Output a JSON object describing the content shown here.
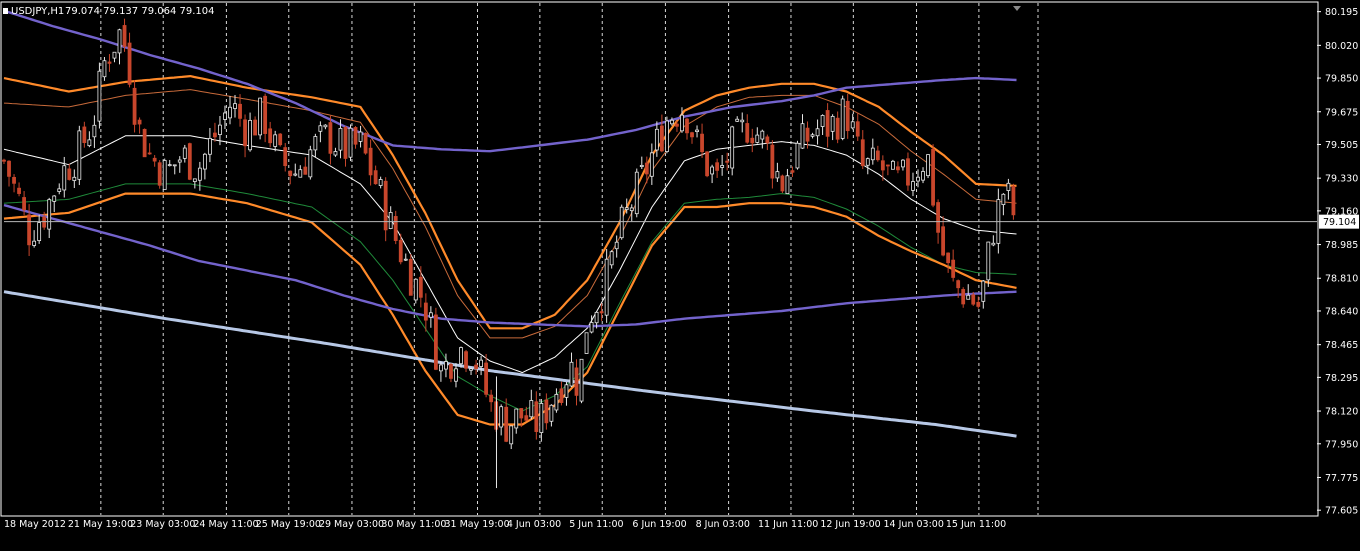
{
  "header": {
    "symbol": "USDJPY,H1",
    "ohlc": "79.074 79.137 79.064 79.104"
  },
  "colors": {
    "background": "#000000",
    "frame": "#ffffff",
    "grid": "#ffffff",
    "bull": "#e8e8e8",
    "bear": "#c8462c",
    "orange_band": "#ff8a2a",
    "thin_band": "#c86a3a",
    "mid_line": "#ffffff",
    "green_line": "#1f8a3a",
    "purple_band": "#7363cc",
    "lightblue_line": "#b7c8e6",
    "price_line": "#b8b8b8"
  },
  "chart_data": {
    "type": "candlestick",
    "title": "USDJPY,H1",
    "current_price": 79.104,
    "ylim": [
      77.58,
      80.24
    ],
    "y_ticks": [
      80.195,
      80.02,
      79.85,
      79.675,
      79.505,
      79.33,
      79.16,
      78.985,
      78.81,
      78.64,
      78.465,
      78.295,
      78.12,
      77.95,
      77.775,
      77.605
    ],
    "x_range": [
      0,
      100
    ],
    "x_ticks": [
      {
        "x": 0.0,
        "label": "18 May 2012"
      },
      {
        "x": 8.5,
        "label": "21 May 19:00"
      },
      {
        "x": 16.2,
        "label": "23 May 03:00"
      },
      {
        "x": 24.0,
        "label": "24 May 11:00"
      },
      {
        "x": 31.7,
        "label": "25 May 19:00"
      },
      {
        "x": 39.5,
        "label": "29 May 03:00"
      },
      {
        "x": 47.2,
        "label": "30 May 11:00"
      },
      {
        "x": 55.0,
        "label": "31 May 19:00"
      },
      {
        "x": 62.7,
        "label": "4 Jun 03:00"
      },
      {
        "x": 70.4,
        "label": "5 Jun 11:00"
      },
      {
        "x": 78.2,
        "label": "6 Jun 19:00"
      },
      {
        "x": 86.0,
        "label": "8 Jun 03:00"
      },
      {
        "x": 93.7,
        "label": "11 Jun 11:00"
      },
      {
        "x": 101.4,
        "label": "12 Jun 19:00"
      },
      {
        "x": 109.2,
        "label": "14 Jun 03:00"
      },
      {
        "x": 116.9,
        "label": "15 Jun 11:00"
      }
    ],
    "price_path": [
      [
        0,
        79.42
      ],
      [
        2,
        79.2
      ],
      [
        3,
        79.05
      ],
      [
        5,
        79.15
      ],
      [
        7,
        79.35
      ],
      [
        9,
        79.45
      ],
      [
        11,
        79.62
      ],
      [
        12.5,
        79.95
      ],
      [
        14.5,
        80.1
      ],
      [
        15.5,
        79.9
      ],
      [
        16.5,
        79.6
      ],
      [
        18,
        79.45
      ],
      [
        20,
        79.35
      ],
      [
        22,
        79.45
      ],
      [
        24,
        79.38
      ],
      [
        26,
        79.55
      ],
      [
        28,
        79.72
      ],
      [
        30,
        79.58
      ],
      [
        32,
        79.66
      ],
      [
        34,
        79.42
      ],
      [
        36,
        79.36
      ],
      [
        38,
        79.48
      ],
      [
        40,
        79.55
      ],
      [
        42,
        79.48
      ],
      [
        44,
        79.5
      ],
      [
        46,
        79.3
      ],
      [
        48,
        79.05
      ],
      [
        50,
        78.85
      ],
      [
        52,
        78.68
      ],
      [
        54,
        78.32
      ],
      [
        56,
        78.45
      ],
      [
        58,
        78.42
      ],
      [
        60,
        78.15
      ],
      [
        62,
        78.05
      ],
      [
        64,
        78.1
      ],
      [
        66,
        78.05
      ],
      [
        68,
        78.22
      ],
      [
        70,
        78.35
      ],
      [
        71,
        78.25
      ],
      [
        72,
        78.6
      ],
      [
        74,
        78.75
      ],
      [
        76,
        79.05
      ],
      [
        78,
        79.25
      ],
      [
        80,
        79.45
      ],
      [
        82,
        79.65
      ],
      [
        84,
        79.7
      ],
      [
        86,
        79.45
      ],
      [
        88,
        79.32
      ],
      [
        90,
        79.5
      ],
      [
        92,
        79.62
      ],
      [
        94,
        79.5
      ],
      [
        96,
        79.3
      ],
      [
        98,
        79.48
      ],
      [
        100,
        79.58
      ],
      [
        102,
        79.6
      ],
      [
        104,
        79.68
      ],
      [
        106,
        79.38
      ],
      [
        108,
        79.4
      ],
      [
        110,
        79.3
      ],
      [
        112,
        79.35
      ],
      [
        114,
        79.45
      ],
      [
        115.5,
        79.0
      ],
      [
        117,
        78.78
      ],
      [
        119,
        78.72
      ],
      [
        120.5,
        78.66
      ],
      [
        122,
        79.05
      ],
      [
        123.5,
        79.28
      ],
      [
        125,
        79.104
      ]
    ],
    "overlays": [
      {
        "role": "orange_upper",
        "x": [
          0,
          8,
          15,
          23,
          30,
          38,
          44,
          48,
          52,
          56,
          60,
          64,
          68,
          72,
          76,
          80,
          84,
          88,
          92,
          96,
          100,
          104,
          108,
          112,
          116,
          120,
          125
        ],
        "y": [
          79.85,
          79.78,
          79.83,
          79.86,
          79.8,
          79.75,
          79.7,
          79.45,
          79.15,
          78.8,
          78.55,
          78.55,
          78.62,
          78.8,
          79.1,
          79.45,
          79.68,
          79.76,
          79.8,
          79.82,
          79.82,
          79.78,
          79.7,
          79.57,
          79.45,
          79.3,
          79.29
        ]
      },
      {
        "role": "thin_upper",
        "x": [
          0,
          8,
          15,
          23,
          30,
          38,
          44,
          48,
          52,
          56,
          60,
          64,
          68,
          72,
          76,
          80,
          84,
          88,
          92,
          96,
          100,
          104,
          108,
          112,
          116,
          120,
          125
        ],
        "y": [
          79.72,
          79.7,
          79.76,
          79.79,
          79.74,
          79.68,
          79.62,
          79.38,
          79.08,
          78.72,
          78.5,
          78.5,
          78.56,
          78.72,
          79.02,
          79.37,
          79.6,
          79.7,
          79.75,
          79.76,
          79.76,
          79.7,
          79.61,
          79.47,
          79.35,
          79.22,
          79.2
        ]
      },
      {
        "role": "mid",
        "x": [
          0,
          8,
          15,
          23,
          30,
          38,
          44,
          48,
          52,
          56,
          60,
          64,
          68,
          72,
          76,
          80,
          84,
          88,
          92,
          96,
          100,
          104,
          108,
          112,
          116,
          120,
          125
        ],
        "y": [
          79.48,
          79.4,
          79.55,
          79.55,
          79.5,
          79.45,
          79.3,
          79.1,
          78.8,
          78.5,
          78.38,
          78.32,
          78.4,
          78.55,
          78.85,
          79.18,
          79.42,
          79.48,
          79.5,
          79.52,
          79.5,
          79.45,
          79.35,
          79.22,
          79.12,
          79.06,
          79.04
        ]
      },
      {
        "role": "green",
        "x": [
          0,
          8,
          15,
          23,
          30,
          38,
          44,
          48,
          52,
          56,
          60,
          64,
          68,
          72,
          76,
          80,
          84,
          88,
          92,
          96,
          100,
          104,
          108,
          112,
          116,
          120,
          125
        ],
        "y": [
          79.2,
          79.22,
          79.3,
          79.3,
          79.25,
          79.18,
          79.0,
          78.8,
          78.55,
          78.3,
          78.2,
          78.12,
          78.2,
          78.35,
          78.68,
          79.0,
          79.2,
          79.22,
          79.23,
          79.25,
          79.23,
          79.17,
          79.08,
          78.97,
          78.88,
          78.84,
          78.83
        ]
      },
      {
        "role": "orange_lower",
        "x": [
          0,
          8,
          15,
          23,
          30,
          38,
          44,
          48,
          52,
          56,
          60,
          64,
          68,
          72,
          76,
          80,
          84,
          88,
          92,
          96,
          100,
          104,
          108,
          112,
          116,
          120,
          125
        ],
        "y": [
          79.12,
          79.15,
          79.25,
          79.25,
          79.2,
          79.1,
          78.88,
          78.62,
          78.33,
          78.1,
          78.05,
          78.05,
          78.15,
          78.32,
          78.65,
          78.98,
          79.18,
          79.18,
          79.2,
          79.2,
          79.18,
          79.13,
          79.03,
          78.95,
          78.88,
          78.8,
          78.76
        ]
      },
      {
        "role": "purple_upper",
        "x": [
          0,
          6,
          12,
          18,
          24,
          30,
          36,
          42,
          48,
          54,
          60,
          66,
          72,
          78,
          84,
          90,
          96,
          100,
          104,
          110,
          116,
          120,
          125
        ],
        "y": [
          80.2,
          80.12,
          80.05,
          79.97,
          79.9,
          79.82,
          79.72,
          79.6,
          79.5,
          79.48,
          79.47,
          79.5,
          79.53,
          79.58,
          79.65,
          79.7,
          79.73,
          79.76,
          79.8,
          79.82,
          79.84,
          79.85,
          79.84
        ]
      },
      {
        "role": "purple_lower",
        "x": [
          0,
          6,
          12,
          18,
          24,
          30,
          36,
          42,
          48,
          54,
          60,
          66,
          72,
          78,
          84,
          90,
          96,
          100,
          104,
          110,
          116,
          120,
          125
        ],
        "y": [
          79.19,
          79.12,
          79.05,
          78.98,
          78.9,
          78.85,
          78.8,
          78.72,
          78.65,
          78.6,
          78.58,
          78.57,
          78.56,
          78.57,
          78.6,
          78.62,
          78.64,
          78.66,
          78.68,
          78.7,
          78.72,
          78.73,
          78.74
        ]
      },
      {
        "role": "lightblue",
        "x": [
          0,
          20,
          40,
          60,
          80,
          100,
          115,
          125
        ],
        "y": [
          78.74,
          78.6,
          78.47,
          78.33,
          78.22,
          78.12,
          78.05,
          77.99
        ]
      }
    ]
  }
}
